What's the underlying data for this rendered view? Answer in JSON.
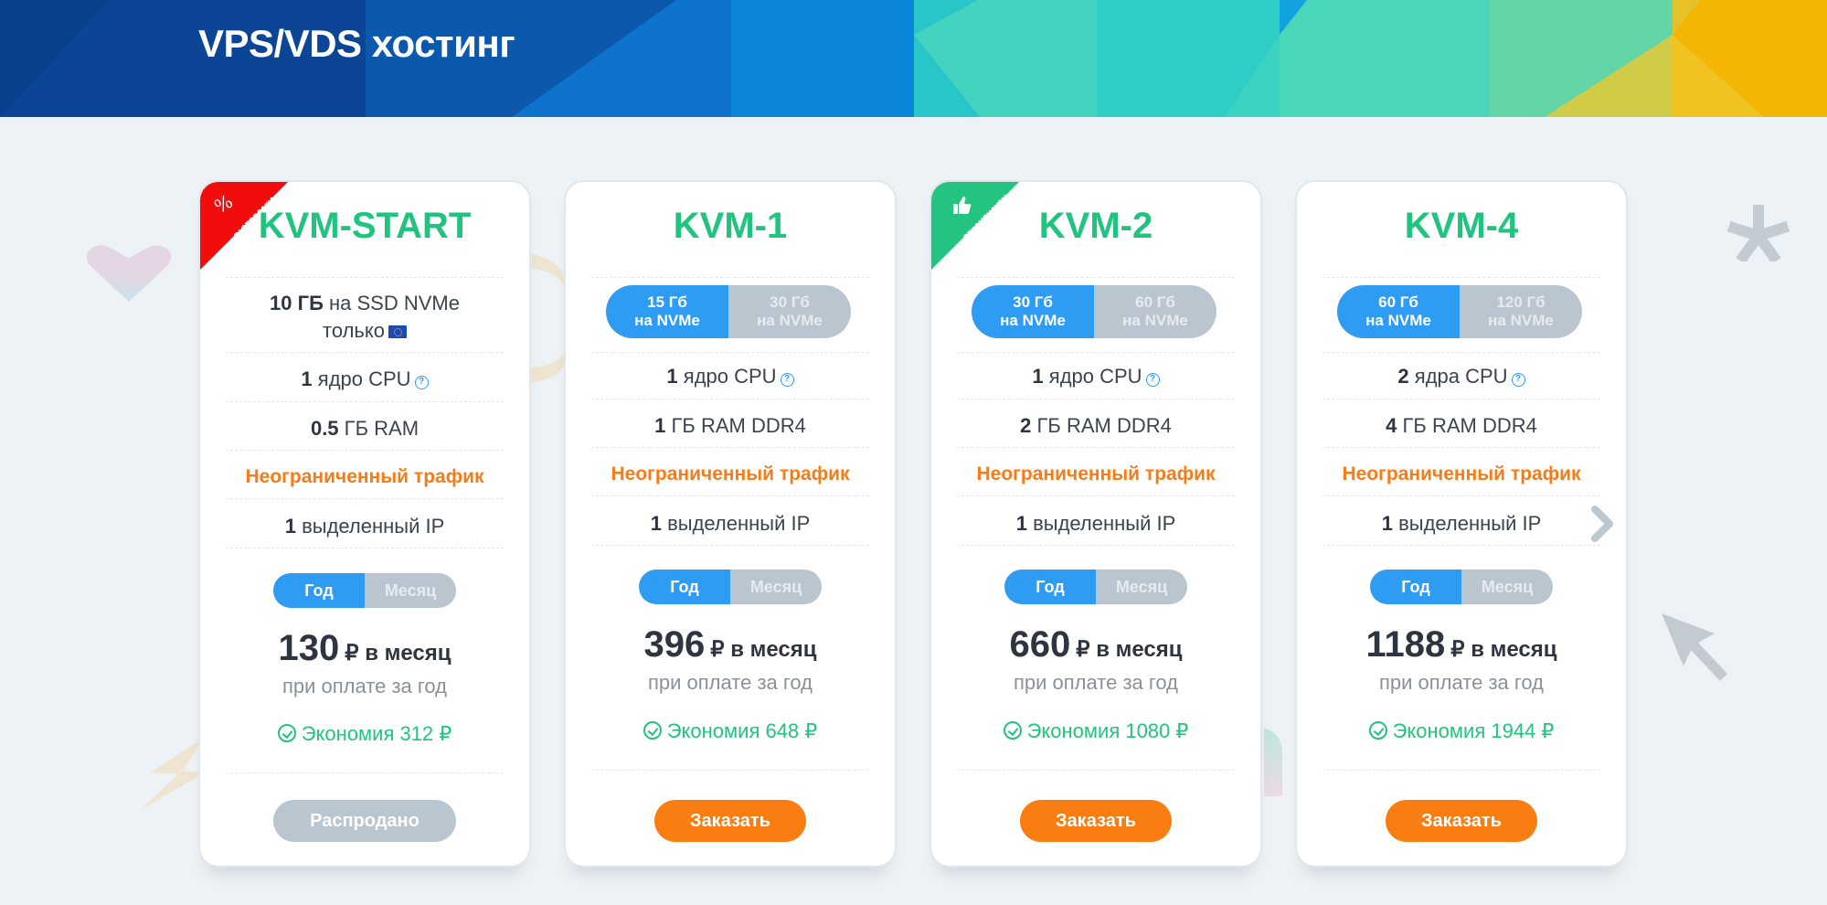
{
  "header": {
    "title": "VPS/VDS хостинг"
  },
  "colors": {
    "plan_name": "#21c47f",
    "traffic": "#f57c17",
    "toggle_active": "#2e9cf2",
    "toggle_inactive": "#bac5cf",
    "order_button": "#fa7d12",
    "sold_out_button": "#b9c5cf",
    "sale_ribbon": "#f20d0d",
    "recommended_ribbon": "#22c47f"
  },
  "plans": [
    {
      "name": "KVM-START",
      "ribbon": {
        "type": "sale",
        "icon": "percent-icon",
        "label": "РАСПРОДАЖА",
        "symbol": "%"
      },
      "disk_bold": "10 ГБ",
      "disk_text": "на SSD NVMe",
      "disk_note": "только",
      "disk_flag": "eu-flag-icon",
      "cpu_bold": "1",
      "cpu_text": "ядро CPU",
      "ram_bold": "0.5",
      "ram_text": "ГБ RAM",
      "traffic": "Неограниченный трафик",
      "ip_bold": "1",
      "ip_text": "выделенный IP",
      "period_options": [
        "Год",
        "Месяц"
      ],
      "period_selected": "Год",
      "price": "130",
      "price_unit": "₽ в месяц",
      "price_note": "при оплате за год",
      "saving": "Экономия 312 ₽",
      "button": "Распродано",
      "button_state": "disabled"
    },
    {
      "name": "KVM-1",
      "disk_options": [
        {
          "line1": "15 Гб",
          "line2": "на NVMe"
        },
        {
          "line1": "30 Гб",
          "line2": "на NVMe"
        }
      ],
      "disk_selected": "15 Гб на NVMe",
      "cpu_bold": "1",
      "cpu_text": "ядро CPU",
      "ram_bold": "1",
      "ram_text": "ГБ RAM DDR4",
      "traffic": "Неограниченный трафик",
      "ip_bold": "1",
      "ip_text": "выделенный IP",
      "period_options": [
        "Год",
        "Месяц"
      ],
      "period_selected": "Год",
      "price": "396",
      "price_unit": "₽ в месяц",
      "price_note": "при оплате за год",
      "saving": "Экономия 648 ₽",
      "button": "Заказать",
      "button_state": "enabled"
    },
    {
      "name": "KVM-2",
      "ribbon": {
        "type": "recommended",
        "icon": "thumbs-up-icon",
        "label": "РЕКОМЕНДУЕМ"
      },
      "disk_options": [
        {
          "line1": "30 Гб",
          "line2": "на NVMe"
        },
        {
          "line1": "60 Гб",
          "line2": "на NVMe"
        }
      ],
      "disk_selected": "30 Гб на NVMe",
      "cpu_bold": "1",
      "cpu_text": "ядро CPU",
      "ram_bold": "2",
      "ram_text": "ГБ RAM DDR4",
      "traffic": "Неограниченный трафик",
      "ip_bold": "1",
      "ip_text": "выделенный IP",
      "period_options": [
        "Год",
        "Месяц"
      ],
      "period_selected": "Год",
      "price": "660",
      "price_unit": "₽ в месяц",
      "price_note": "при оплате за год",
      "saving": "Экономия 1080 ₽",
      "button": "Заказать",
      "button_state": "enabled"
    },
    {
      "name": "KVM-4",
      "disk_options": [
        {
          "line1": "60 Гб",
          "line2": "на NVMe"
        },
        {
          "line1": "120 Гб",
          "line2": "на NVMe"
        }
      ],
      "disk_selected": "60 Гб на NVMe",
      "cpu_bold": "2",
      "cpu_text": "ядра CPU",
      "ram_bold": "4",
      "ram_text": "ГБ RAM DDR4",
      "traffic": "Неограниченный трафик",
      "ip_bold": "1",
      "ip_text": "выделенный IP",
      "period_options": [
        "Год",
        "Месяц"
      ],
      "period_selected": "Год",
      "price": "1188",
      "price_unit": "₽ в месяц",
      "price_note": "при оплате за год",
      "saving": "Экономия 1944 ₽",
      "button": "Заказать",
      "button_state": "enabled"
    }
  ],
  "carousel": {
    "next_icon": "chevron-right-icon"
  }
}
